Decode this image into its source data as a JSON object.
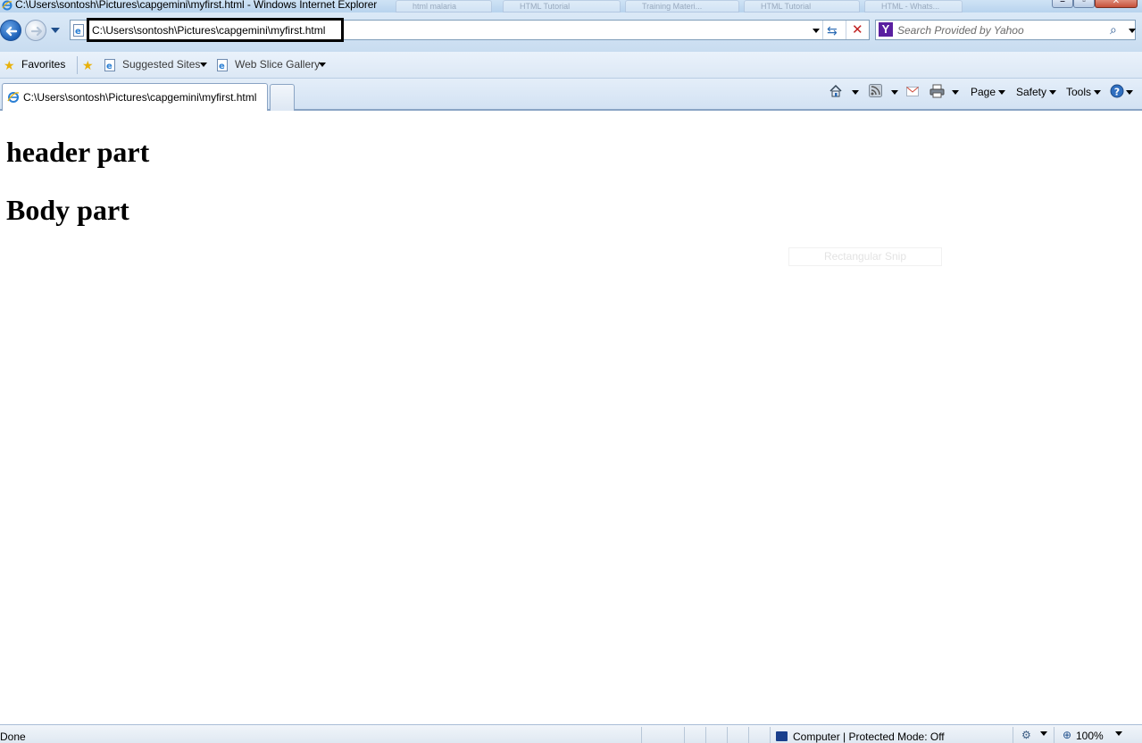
{
  "window": {
    "title": "C:\\Users\\sontosh\\Pictures\\capgemini\\myfirst.html - Windows Internet Explorer",
    "background_tabs": [
      "html malaria",
      "HTML Tutorial",
      "Training Materi...",
      "HTML Tutorial",
      "HTML - Whats..."
    ]
  },
  "address_bar": {
    "url": "C:\\Users\\sontosh\\Pictures\\capgemini\\myfirst.html"
  },
  "search": {
    "placeholder": "Search Provided by Yahoo",
    "provider_icon": "Y"
  },
  "favorites_bar": {
    "favorites_label": "Favorites",
    "items": [
      {
        "label": "Suggested Sites",
        "icon": "ie-page-icon"
      },
      {
        "label": "Web Slice Gallery",
        "icon": "ie-page-icon"
      }
    ]
  },
  "tabs": [
    {
      "title": "C:\\Users\\sontosh\\Pictures\\capgemini\\myfirst.html",
      "active": true
    }
  ],
  "command_bar": {
    "page": "Page",
    "safety": "Safety",
    "tools": "Tools",
    "icons": [
      "home-icon",
      "feeds-icon",
      "read-mail-icon",
      "print-icon",
      "help-icon"
    ]
  },
  "page": {
    "header_text": "header part",
    "body_text": "Body part",
    "overlay_ghost": "Rectangular Snip"
  },
  "status_bar": {
    "status": "Done",
    "zone": "Computer | Protected Mode: Off",
    "zoom": "100%"
  },
  "colors": {
    "chrome": "#d3e2f3",
    "address_highlight": "#000000",
    "yahoo": "#5a1fa0"
  }
}
